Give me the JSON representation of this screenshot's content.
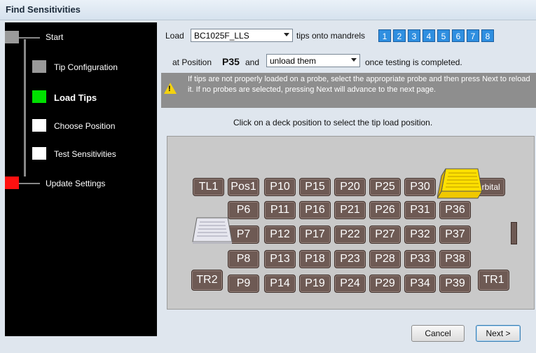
{
  "window": {
    "title": "Find Sensitivities"
  },
  "sidebar": {
    "steps": [
      {
        "label": "Start",
        "color": "#9a9a9a"
      },
      {
        "label": "Tip Configuration",
        "color": "#9a9a9a"
      },
      {
        "label": "Load Tips",
        "color": "#00e000",
        "current": true
      },
      {
        "label": "Choose Position",
        "color": "#ffffff"
      },
      {
        "label": "Test Sensitivities",
        "color": "#ffffff"
      },
      {
        "label": "Update Settings",
        "color": "#ff1010"
      }
    ]
  },
  "load_row": {
    "load_label": "Load",
    "tip_type_value": "BC1025F_LLS",
    "tips_onto_label": "tips onto mandrels",
    "mandrels": [
      "1",
      "2",
      "3",
      "4",
      "5",
      "6",
      "7",
      "8"
    ]
  },
  "position_row": {
    "at_position_label": "at Position",
    "position_value": "P35",
    "and_label": "and",
    "action_value": "unload them",
    "completion_label": "once testing is completed."
  },
  "warning": {
    "icon": "warning-icon",
    "text": "If tips are not properly loaded on a probe, select the appropriate probe and then press Next to reload it.  If no probes are selected, pressing Next will advance to the next page."
  },
  "instruction": "Click on a deck position to select the tip load position.",
  "deck": {
    "row1": [
      "TL1",
      "Pos1",
      "P10",
      "P15",
      "P20",
      "P25",
      "P30",
      "Orbital"
    ],
    "row2": [
      "P6",
      "P11",
      "P16",
      "P21",
      "P26",
      "P31",
      "P36"
    ],
    "row3": [
      "P7",
      "P12",
      "P17",
      "P22",
      "P27",
      "P32",
      "P37"
    ],
    "row4": [
      "P8",
      "P13",
      "P18",
      "P23",
      "P28",
      "P33",
      "P38"
    ],
    "row5": [
      "TR2",
      "P9",
      "P14",
      "P19",
      "P24",
      "P29",
      "P34",
      "P39",
      "TR1"
    ]
  },
  "buttons": {
    "cancel": "Cancel",
    "next": "Next >"
  }
}
